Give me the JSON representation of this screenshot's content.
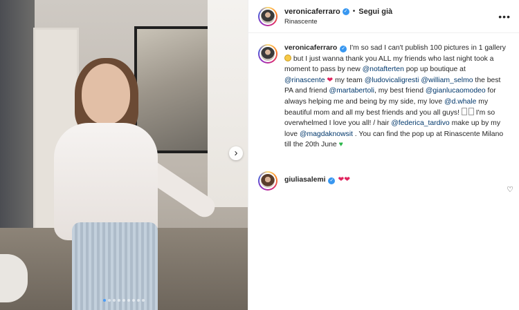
{
  "header": {
    "username": "veronicaferraro",
    "verified_mark": "✓",
    "separator": "•",
    "follow_label": "Segui già",
    "location": "Rinascente",
    "more_label": "•••"
  },
  "caption": {
    "username": "veronicaferraro",
    "verified_mark": "✓",
    "t1": "I'm so sad I can't publish 100 pictures in 1 gallery ",
    "t2": " but I just wanna thank you ALL my friends who last night took a moment to pass by new ",
    "m1": "@notafterten",
    "t3": " pop up boutique at ",
    "m2": "@rinascente",
    "heart1": "❤",
    "t4": " my team ",
    "m3": "@ludovicaligresti",
    "t5": " ",
    "m4": "@william_selmo",
    "t6": " the best PA and friend ",
    "m5": "@martabertoli",
    "t7": ", my best friend ",
    "m6": "@gianlucaomodeo",
    "t8": " for always helping me and being by my side, my love ",
    "m7": "@d.whale",
    "t9": " my beautiful mom and all my best friends and you all guys! ",
    "t10": " I'm so overwhelmed I love you all! / hair ",
    "m8": "@federica_tardivo",
    "t11": " make up by my love ",
    "m9": "@magdaknowsit",
    "t12": " . You can find the pop up at Rinascente Milano till the 20th June ",
    "green_heart": "♥"
  },
  "comment": {
    "username": "giuliasalemi",
    "verified_mark": "✓",
    "hearts": "❤❤",
    "like_icon": "♡"
  },
  "media": {
    "next_icon": "›",
    "slide_count": 9,
    "active_slide": 1
  },
  "colors": {
    "verified": "#3897f0",
    "mention": "#00376b",
    "heart": "#e0245e",
    "green_heart": "#2bb64a",
    "active_dot": "#4a9df8"
  }
}
